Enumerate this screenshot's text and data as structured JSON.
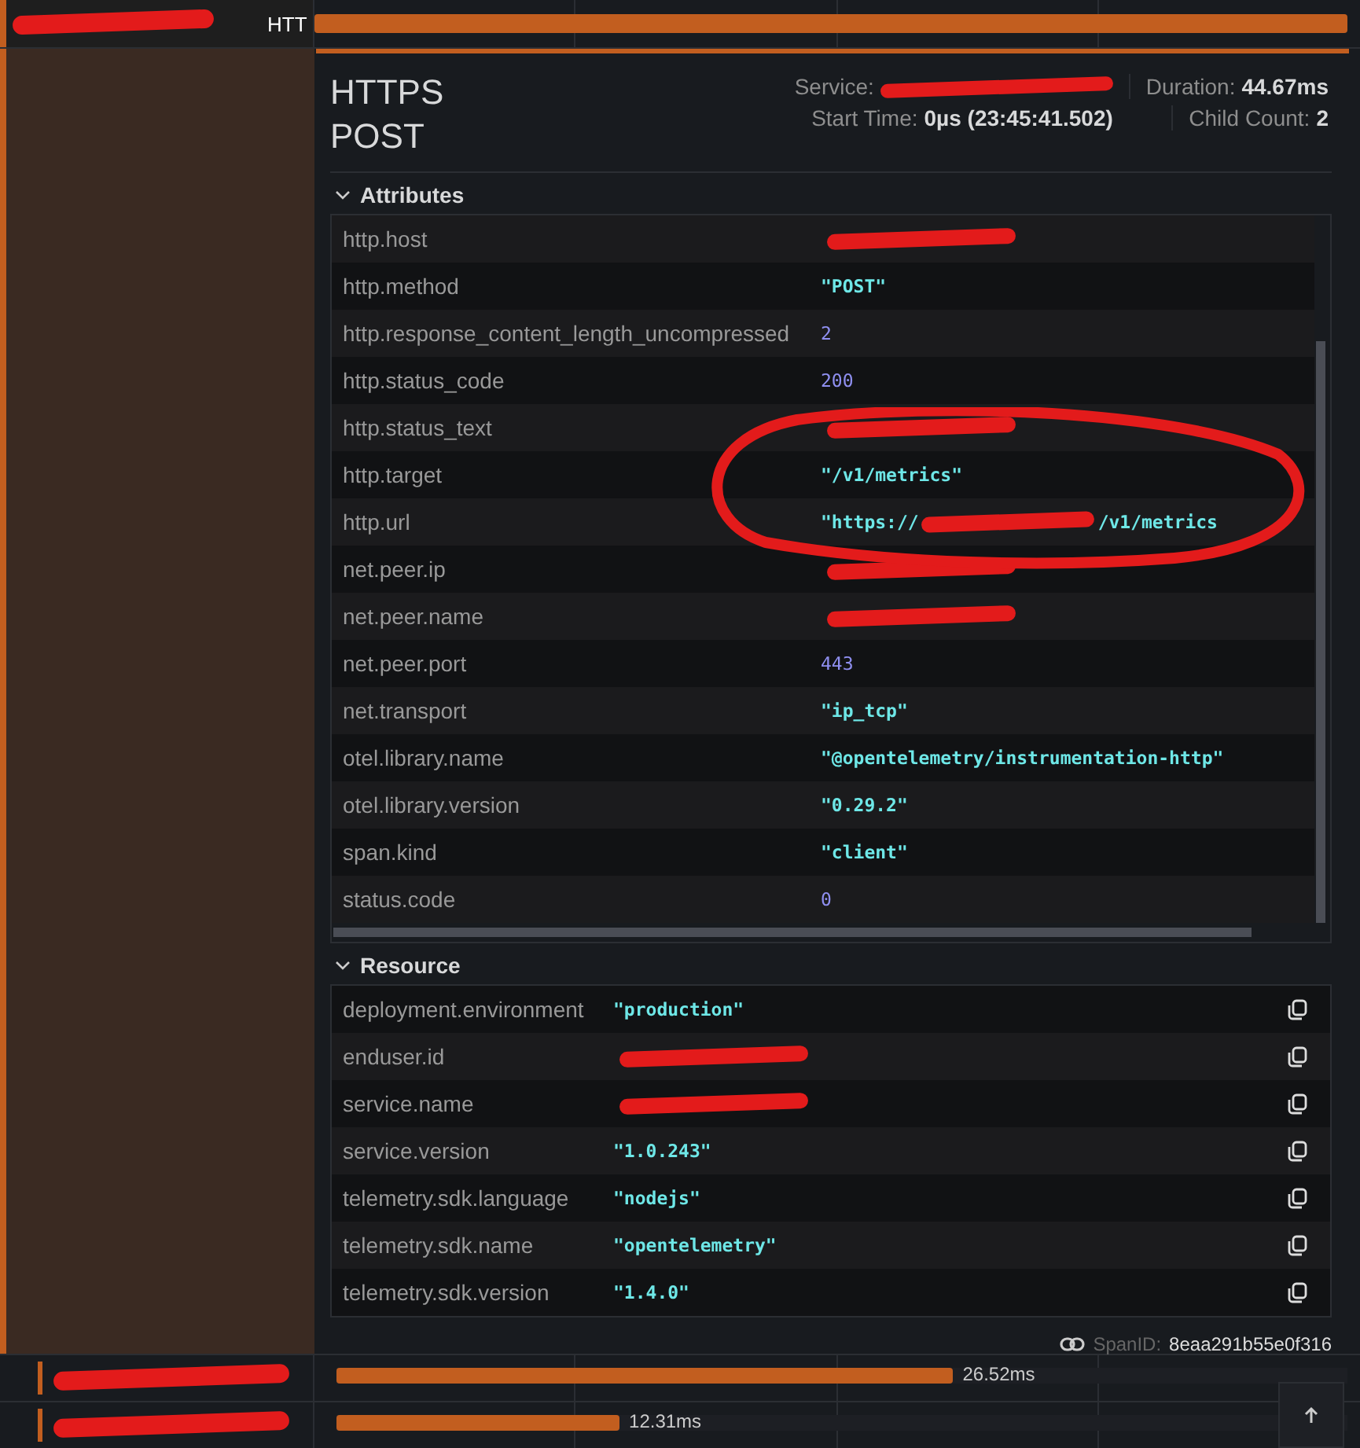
{
  "top_span": {
    "label": "HTT"
  },
  "detail": {
    "title": "HTTPS POST",
    "meta": [
      {
        "label": "Service:",
        "redacted": true
      },
      {
        "label": "Duration:",
        "value": "44.67ms"
      },
      {
        "label": "Start Time:",
        "value": "0µs (23:45:41.502)"
      },
      {
        "label": "Child Count:",
        "value": "2"
      }
    ]
  },
  "attributes": {
    "title": "Attributes",
    "expanded": true,
    "rows": [
      {
        "key": "http.host",
        "redacted": true
      },
      {
        "key": "http.method",
        "value": "\"POST\"",
        "kind": "string"
      },
      {
        "key": "http.response_content_length_uncompressed",
        "value": "2",
        "kind": "number"
      },
      {
        "key": "http.status_code",
        "value": "200",
        "kind": "number"
      },
      {
        "key": "http.status_text",
        "redacted": true
      },
      {
        "key": "http.target",
        "value": "\"/v1/metrics\"",
        "kind": "string"
      },
      {
        "key": "http.url",
        "value": "\"https://",
        "value_tail": "/v1/metrics",
        "redacted": true,
        "kind": "string"
      },
      {
        "key": "net.peer.ip",
        "redacted": true
      },
      {
        "key": "net.peer.name",
        "redacted": true
      },
      {
        "key": "net.peer.port",
        "value": "443",
        "kind": "number"
      },
      {
        "key": "net.transport",
        "value": "\"ip_tcp\"",
        "kind": "string"
      },
      {
        "key": "otel.library.name",
        "value": "\"@opentelemetry/instrumentation-http\"",
        "kind": "string"
      },
      {
        "key": "otel.library.version",
        "value": "\"0.29.2\"",
        "kind": "string"
      },
      {
        "key": "span.kind",
        "value": "\"client\"",
        "kind": "string"
      },
      {
        "key": "status.code",
        "value": "0",
        "kind": "number"
      }
    ]
  },
  "resource": {
    "title": "Resource",
    "expanded": true,
    "rows": [
      {
        "key": "deployment.environment",
        "value": "\"production\"",
        "kind": "string"
      },
      {
        "key": "enduser.id",
        "redacted": true
      },
      {
        "key": "service.name",
        "redacted": true
      },
      {
        "key": "service.version",
        "value": "\"1.0.243\"",
        "kind": "string"
      },
      {
        "key": "telemetry.sdk.language",
        "value": "\"nodejs\"",
        "kind": "string"
      },
      {
        "key": "telemetry.sdk.name",
        "value": "\"opentelemetry\"",
        "kind": "string"
      },
      {
        "key": "telemetry.sdk.version",
        "value": "\"1.4.0\"",
        "kind": "string"
      }
    ]
  },
  "span_id": {
    "label": "SpanID:",
    "value": "8eaa291b55e0f316"
  },
  "child_spans": [
    {
      "duration": "26.52ms",
      "level": 0.61
    },
    {
      "duration": "12.31ms",
      "level": 0.28
    }
  ]
}
